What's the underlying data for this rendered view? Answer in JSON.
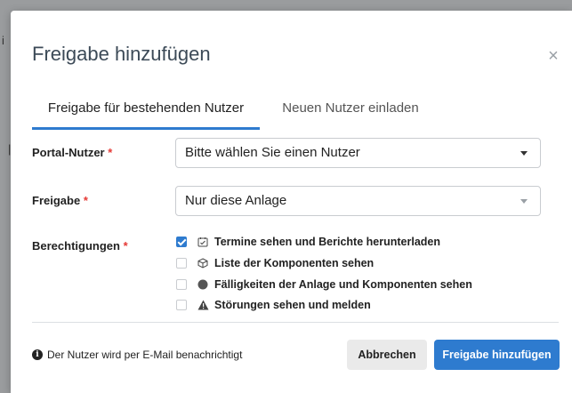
{
  "backdrop": {
    "text1": "i",
    "text2": "|"
  },
  "dialog": {
    "title": "Freigabe hinzufügen",
    "close_label": "×",
    "tabs": [
      {
        "label": "Freigabe für bestehenden Nutzer",
        "active": true
      },
      {
        "label": "Neuen Nutzer einladen",
        "active": false
      }
    ],
    "fields": {
      "portal_user": {
        "label": "Portal-Nutzer",
        "required": "*",
        "value": "Bitte wählen Sie einen Nutzer"
      },
      "release": {
        "label": "Freigabe",
        "required": "*",
        "value": "Nur diese Anlage"
      },
      "permissions": {
        "label": "Berechtigungen",
        "required": "*",
        "items": [
          {
            "label": "Termine sehen und Berichte herunterladen",
            "checked": true,
            "icon": "calendar-check-icon"
          },
          {
            "label": "Liste der Komponenten sehen",
            "checked": false,
            "icon": "cube-icon"
          },
          {
            "label": "Fälligkeiten der Anlage und Komponenten sehen",
            "checked": false,
            "icon": "circle-icon"
          },
          {
            "label": "Störungen sehen und melden",
            "checked": false,
            "icon": "warning-icon"
          }
        ]
      }
    },
    "footer": {
      "info_icon": "i",
      "info_text": "Der Nutzer wird per E-Mail benachrichtigt",
      "cancel_label": "Abbrechen",
      "submit_label": "Freigabe hinzufügen"
    }
  },
  "colors": {
    "accent": "#2e7bcf",
    "required": "#e53935",
    "cancel_bg": "#eaeaea"
  }
}
